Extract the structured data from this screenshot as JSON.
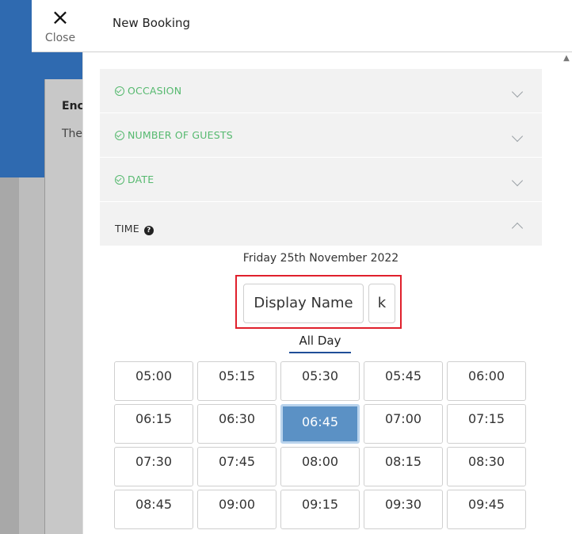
{
  "background": {
    "heading": "Enc",
    "subtext": "The"
  },
  "header": {
    "close_label": "Close",
    "close_icon": "×",
    "title": "New Booking"
  },
  "accordion": [
    {
      "label": "OCCASION",
      "state": "done"
    },
    {
      "label": "NUMBER OF GUESTS",
      "state": "done"
    },
    {
      "label": "DATE",
      "state": "done"
    },
    {
      "label": "TIME",
      "state": "open"
    }
  ],
  "time_section": {
    "help_icon": "?",
    "selected_date": "Friday 25th November 2022",
    "display_name_label": "Display Name",
    "k_label": "k",
    "filter_tab": "All Day",
    "slots": [
      "05:00",
      "05:15",
      "05:30",
      "05:45",
      "06:00",
      "06:15",
      "06:30",
      "06:45",
      "07:00",
      "07:15",
      "07:30",
      "07:45",
      "08:00",
      "08:15",
      "08:30",
      "08:45",
      "09:00",
      "09:15",
      "09:30",
      "09:45"
    ],
    "selected_slot": "06:45"
  },
  "colors": {
    "accent_blue": "#2f6ab0",
    "completed_green": "#56b96f",
    "selected_slot": "#5b91c5",
    "highlight_red": "#e0202c"
  }
}
